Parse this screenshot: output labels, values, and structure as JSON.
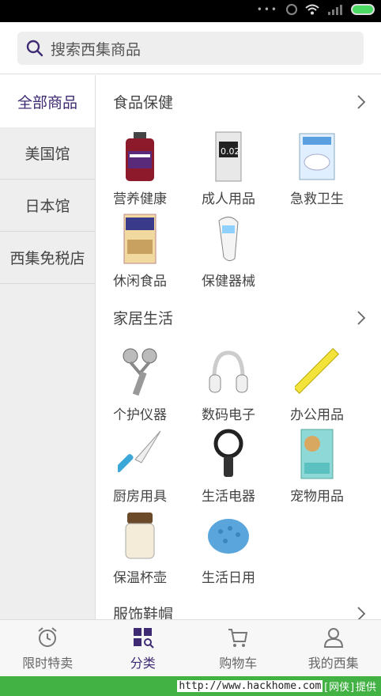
{
  "statusbar": {
    "dots": "•••"
  },
  "search": {
    "placeholder": "搜索西集商品"
  },
  "sidebar": {
    "items": [
      {
        "label": "全部商品"
      },
      {
        "label": "美国馆"
      },
      {
        "label": "日本馆"
      },
      {
        "label": "西集免税店"
      }
    ]
  },
  "sections": [
    {
      "title": "食品保健",
      "items": [
        {
          "label": "营养健康",
          "icon": "supplement-bottle-icon"
        },
        {
          "label": "成人用品",
          "icon": "box-icon"
        },
        {
          "label": "急救卫生",
          "icon": "face-mask-icon"
        },
        {
          "label": "休闲食品",
          "icon": "snack-box-icon"
        },
        {
          "label": "保健器械",
          "icon": "thermometer-icon"
        }
      ]
    },
    {
      "title": "家居生活",
      "items": [
        {
          "label": "个护仪器",
          "icon": "face-roller-icon"
        },
        {
          "label": "数码电子",
          "icon": "headphones-icon"
        },
        {
          "label": "办公用品",
          "icon": "ruler-icon"
        },
        {
          "label": "厨房用具",
          "icon": "knife-icon"
        },
        {
          "label": "生活电器",
          "icon": "bladeless-fan-icon"
        },
        {
          "label": "宠物用品",
          "icon": "pet-pad-icon"
        },
        {
          "label": "保温杯壶",
          "icon": "food-jar-icon"
        },
        {
          "label": "生活日用",
          "icon": "laundry-ball-icon"
        }
      ]
    },
    {
      "title": "服饰鞋帽"
    }
  ],
  "tabbar": {
    "tabs": [
      {
        "label": "限时特卖",
        "icon": "alarm-clock-icon"
      },
      {
        "label": "分类",
        "icon": "category-grid-icon"
      },
      {
        "label": "购物车",
        "icon": "cart-icon"
      },
      {
        "label": "我的西集",
        "icon": "person-icon"
      }
    ]
  },
  "footer": {
    "url": "http://www.hackhome.com",
    "tag": "[网侠]提供"
  },
  "colors": {
    "accent": "#3e2a73",
    "footer_green": "#43b245"
  }
}
